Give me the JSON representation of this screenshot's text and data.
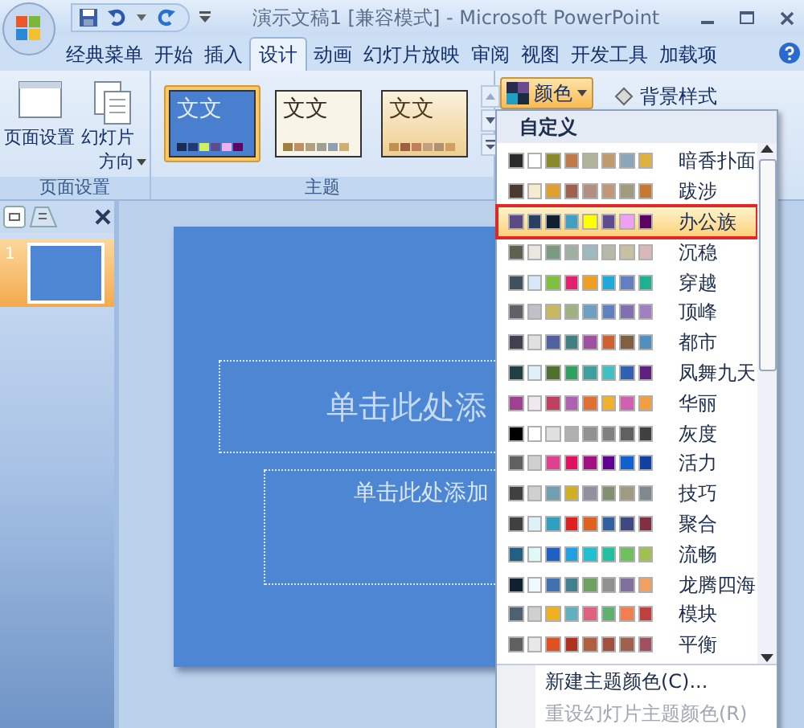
{
  "title_bar": {
    "title": "演示文稿1 [兼容模式] - Microsoft PowerPoint"
  },
  "tabs": [
    {
      "label": "经典菜单",
      "selected": false
    },
    {
      "label": "开始",
      "selected": false
    },
    {
      "label": "插入",
      "selected": false
    },
    {
      "label": "设计",
      "selected": true
    },
    {
      "label": "动画",
      "selected": false
    },
    {
      "label": "幻灯片放映",
      "selected": false
    },
    {
      "label": "审阅",
      "selected": false
    },
    {
      "label": "视图",
      "selected": false
    },
    {
      "label": "开发工具",
      "selected": false
    },
    {
      "label": "加载项",
      "selected": false
    }
  ],
  "page_setup_group": {
    "label": "页面设置",
    "buttons": [
      "页面设置",
      "幻灯片方向"
    ]
  },
  "themes_group": {
    "label": "主题",
    "themes": [
      {
        "sample": "文文",
        "selected": true,
        "swatches": [
          {
            "color": "#1a2a50"
          },
          {
            "color": "#203a70"
          },
          {
            "color": "#d0f060"
          },
          {
            "color": "#604a90"
          },
          {
            "color": "#f0b0f0"
          },
          {
            "color": "#600060"
          }
        ]
      },
      {
        "sample": "文文",
        "selected": false,
        "swatches": [
          {
            "color": "#a08040"
          },
          {
            "color": "#c09060"
          },
          {
            "color": "#b0a080"
          },
          {
            "color": "#a0a090"
          },
          {
            "color": "#90a0b0"
          },
          {
            "color": "#d0b070"
          }
        ]
      },
      {
        "sample": "文文",
        "selected": false,
        "swatches": [
          {
            "color": "#c09050"
          },
          {
            "color": "#a06040"
          },
          {
            "color": "#c08060"
          },
          {
            "color": "#c0a080"
          },
          {
            "color": "#b09070"
          },
          {
            "color": "#d0a060"
          }
        ]
      }
    ]
  },
  "colors_button": {
    "label": "颜色",
    "expanded": true
  },
  "background_button": {
    "label": "背景样式"
  },
  "slides_pane": {
    "slides": [
      {
        "number": "1",
        "selected": true
      }
    ]
  },
  "slide": {
    "title_placeholder": "单击此处添",
    "subtitle_placeholder": "单击此处添加"
  },
  "colors_menu": {
    "header": "自定义",
    "schemes": [
      {
        "name": "暗香扑面",
        "selected": false,
        "swatches": [
          {
            "color": "#2b2b2b"
          },
          {
            "color": "#ffffff"
          },
          {
            "color": "#8a8a2a"
          },
          {
            "color": "#c07a4a"
          },
          {
            "color": "#b0b49a"
          },
          {
            "color": "#c09a6a"
          },
          {
            "color": "#8aa6b8"
          },
          {
            "color": "#e0b040"
          }
        ]
      },
      {
        "name": "跋涉",
        "selected": false,
        "swatches": [
          {
            "color": "#4a3a30"
          },
          {
            "color": "#f5ecd0"
          },
          {
            "color": "#e0a030"
          },
          {
            "color": "#a06050"
          },
          {
            "color": "#b09080"
          },
          {
            "color": "#c09878"
          },
          {
            "color": "#a09a80"
          },
          {
            "color": "#c87830"
          }
        ]
      },
      {
        "name": "办公族",
        "selected": true,
        "swatches": [
          {
            "color": "#5a4a80"
          },
          {
            "color": "#2a4060"
          },
          {
            "color": "#102030"
          },
          {
            "color": "#40a0c0"
          },
          {
            "color": "#ffff00"
          },
          {
            "color": "#604a90"
          },
          {
            "color": "#f0a0f0"
          },
          {
            "color": "#600060"
          }
        ]
      },
      {
        "name": "沉稳",
        "selected": false,
        "swatches": [
          {
            "color": "#606050"
          },
          {
            "color": "#e8e8e0"
          },
          {
            "color": "#7a9a80"
          },
          {
            "color": "#a0b0a0"
          },
          {
            "color": "#a0b8c0"
          },
          {
            "color": "#b8b8a8"
          },
          {
            "color": "#c8c0a0"
          },
          {
            "color": "#d8b8b8"
          }
        ]
      },
      {
        "name": "穿越",
        "selected": false,
        "swatches": [
          {
            "color": "#405060"
          },
          {
            "color": "#d8e8f8"
          },
          {
            "color": "#80c040"
          },
          {
            "color": "#e02070"
          },
          {
            "color": "#f0a020"
          },
          {
            "color": "#20a8d8"
          },
          {
            "color": "#6080c0"
          },
          {
            "color": "#20b090"
          }
        ]
      },
      {
        "name": "顶峰",
        "selected": false,
        "swatches": [
          {
            "color": "#606068"
          },
          {
            "color": "#c0c0c8"
          },
          {
            "color": "#c8b860"
          },
          {
            "color": "#a0b080"
          },
          {
            "color": "#70a0c0"
          },
          {
            "color": "#6080c0"
          },
          {
            "color": "#8070b0"
          },
          {
            "color": "#a080c0"
          }
        ]
      },
      {
        "name": "都市",
        "selected": false,
        "swatches": [
          {
            "color": "#404050"
          },
          {
            "color": "#e0e0e0"
          },
          {
            "color": "#5060a0"
          },
          {
            "color": "#408080"
          },
          {
            "color": "#a050a0"
          },
          {
            "color": "#d06030"
          },
          {
            "color": "#806040"
          },
          {
            "color": "#5090c0"
          }
        ]
      },
      {
        "name": "凤舞九天",
        "selected": false,
        "swatches": [
          {
            "color": "#204040"
          },
          {
            "color": "#e0f0f8"
          },
          {
            "color": "#507030"
          },
          {
            "color": "#30a060"
          },
          {
            "color": "#40a0a0"
          },
          {
            "color": "#40c0c0"
          },
          {
            "color": "#3060b0"
          },
          {
            "color": "#602080"
          }
        ]
      },
      {
        "name": "华丽",
        "selected": false,
        "swatches": [
          {
            "color": "#a04090"
          },
          {
            "color": "#f0e8f0"
          },
          {
            "color": "#c04060"
          },
          {
            "color": "#b060b0"
          },
          {
            "color": "#e07030"
          },
          {
            "color": "#f0b030"
          },
          {
            "color": "#d060b0"
          },
          {
            "color": "#f0a040"
          }
        ]
      },
      {
        "name": "灰度",
        "selected": false,
        "swatches": [
          {
            "color": "#000000"
          },
          {
            "color": "#ffffff"
          },
          {
            "color": "#e0e0e0"
          },
          {
            "color": "#b0b0b0"
          },
          {
            "color": "#909090"
          },
          {
            "color": "#808080"
          },
          {
            "color": "#606060"
          },
          {
            "color": "#404040"
          }
        ]
      },
      {
        "name": "活力",
        "selected": false,
        "swatches": [
          {
            "color": "#606060"
          },
          {
            "color": "#d0d0d0"
          },
          {
            "color": "#e04090"
          },
          {
            "color": "#e01060"
          },
          {
            "color": "#a01080"
          },
          {
            "color": "#600090"
          },
          {
            "color": "#1060d0"
          },
          {
            "color": "#1040a0"
          }
        ]
      },
      {
        "name": "技巧",
        "selected": false,
        "swatches": [
          {
            "color": "#404040"
          },
          {
            "color": "#d0d0d0"
          },
          {
            "color": "#70a0b0"
          },
          {
            "color": "#d0b020"
          },
          {
            "color": "#9090a0"
          },
          {
            "color": "#809070"
          },
          {
            "color": "#a09a80"
          },
          {
            "color": "#808890"
          }
        ]
      },
      {
        "name": "聚合",
        "selected": false,
        "swatches": [
          {
            "color": "#404040"
          },
          {
            "color": "#e0f0f8"
          },
          {
            "color": "#30a0c0"
          },
          {
            "color": "#e02020"
          },
          {
            "color": "#e06020"
          },
          {
            "color": "#3060a0"
          },
          {
            "color": "#404880"
          },
          {
            "color": "#803040"
          }
        ]
      },
      {
        "name": "流畅",
        "selected": false,
        "swatches": [
          {
            "color": "#206080"
          },
          {
            "color": "#e0f8f8"
          },
          {
            "color": "#2060c0"
          },
          {
            "color": "#20a0e0"
          },
          {
            "color": "#20c0d0"
          },
          {
            "color": "#20c0a0"
          },
          {
            "color": "#70c060"
          },
          {
            "color": "#a0c050"
          }
        ]
      },
      {
        "name": "龙腾四海",
        "selected": false,
        "swatches": [
          {
            "color": "#102030"
          },
          {
            "color": "#f0f8ff"
          },
          {
            "color": "#4070b0"
          },
          {
            "color": "#408090"
          },
          {
            "color": "#70a060"
          },
          {
            "color": "#909090"
          },
          {
            "color": "#8070a0"
          },
          {
            "color": "#f0a060"
          }
        ]
      },
      {
        "name": "模块",
        "selected": false,
        "swatches": [
          {
            "color": "#506070"
          },
          {
            "color": "#d0d0d0"
          },
          {
            "color": "#f0b020"
          },
          {
            "color": "#60b0c0"
          },
          {
            "color": "#e06080"
          },
          {
            "color": "#60b070"
          },
          {
            "color": "#f08050"
          },
          {
            "color": "#c04040"
          }
        ]
      },
      {
        "name": "平衡",
        "selected": false,
        "swatches": [
          {
            "color": "#606060"
          },
          {
            "color": "#e8e8e8"
          },
          {
            "color": "#e05020"
          },
          {
            "color": "#b03020"
          },
          {
            "color": "#b06040"
          },
          {
            "color": "#a05040"
          },
          {
            "color": "#a06050"
          },
          {
            "color": "#a05060"
          }
        ]
      }
    ],
    "commands": [
      {
        "label": "新建主题颜色(C)...",
        "disabled": false
      },
      {
        "label": "重设幻灯片主题颜色(R)",
        "disabled": true
      }
    ]
  }
}
